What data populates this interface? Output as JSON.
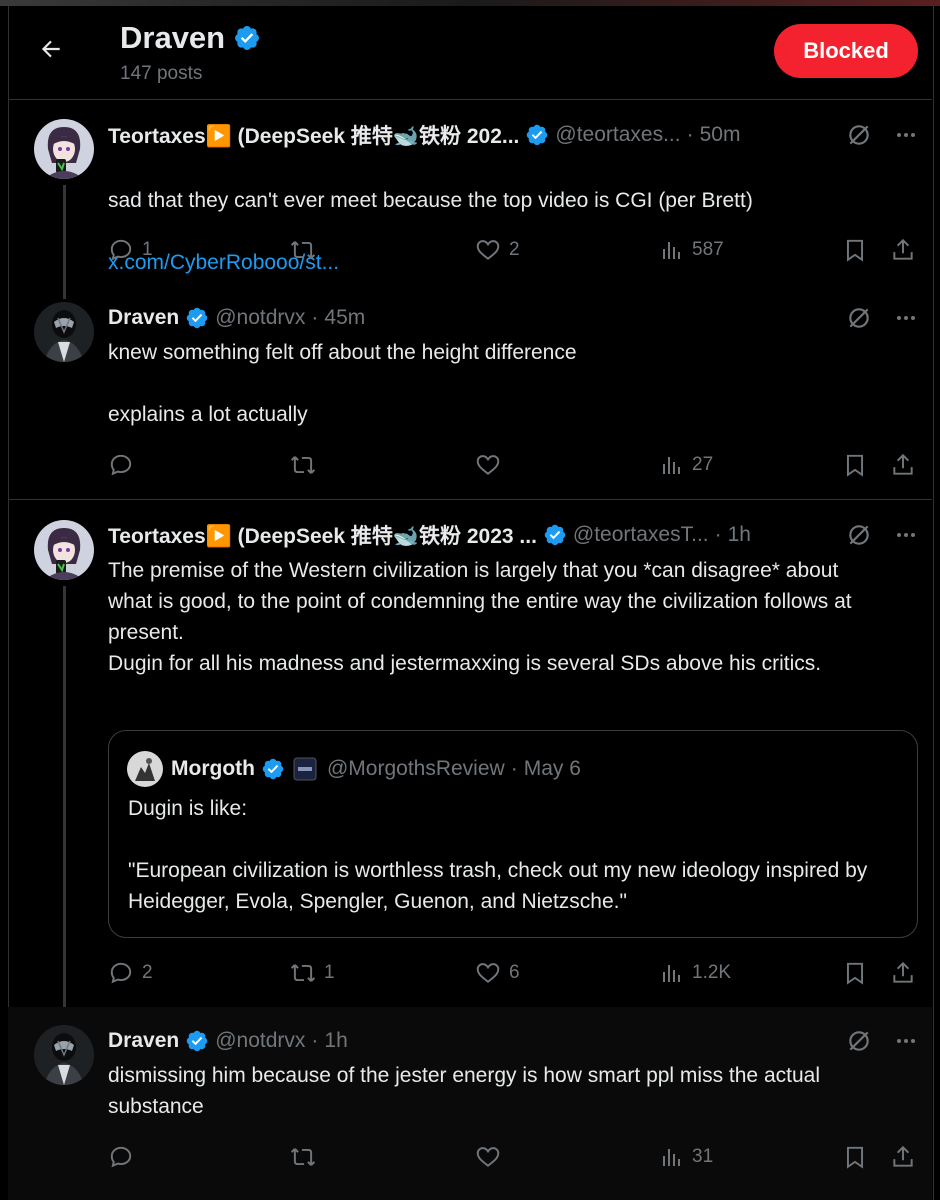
{
  "header": {
    "name": "Draven",
    "post_count": "147 posts",
    "blocked_label": "Blocked"
  },
  "colors": {
    "accent": "#1d9bf0",
    "danger": "#f4212e",
    "muted": "#71767b",
    "text": "#e7e9ea"
  },
  "tweets": [
    {
      "name": "Teortaxes▶️ (DeepSeek 推特🐋铁粉 202...",
      "handle": "@teortaxes...",
      "time": "50m",
      "text": "sad that they can't ever meet because the top video is CGI (per Brett)",
      "link": "x.com/CyberRobooo/st...",
      "replies": "1",
      "retweets": "",
      "likes": "2",
      "views": "587"
    },
    {
      "name": "Draven",
      "handle": "@notdrvx",
      "time": "45m",
      "text": "knew something felt off about the height difference\n\nexplains a lot actually",
      "replies": "",
      "retweets": "",
      "likes": "",
      "views": "27"
    },
    {
      "name": "Teortaxes▶️ (DeepSeek 推特🐋铁粉 2023 ...",
      "handle": "@teortaxesT...",
      "time": "1h",
      "text": "The premise of the Western civilization is largely that you *can disagree* about what is good, to the point of condemning the entire way the civilization follows at present.\nDugin for all his madness and jestermaxxing is several SDs above his critics.",
      "quote": {
        "name": "Morgoth",
        "handle": "@MorgothsReview",
        "date": "May 6",
        "text": "Dugin is like:\n\n \"European civilization is worthless trash, check out my new ideology inspired by Heidegger, Evola, Spengler, Guenon, and Nietzsche.\""
      },
      "replies": "2",
      "retweets": "1",
      "likes": "6",
      "views": "1.2K"
    },
    {
      "name": "Draven",
      "handle": "@notdrvx",
      "time": "1h",
      "text": "dismissing him because of the jester energy is how smart ppl miss the actual substance",
      "replies": "",
      "retweets": "",
      "likes": "",
      "views": "31"
    }
  ]
}
